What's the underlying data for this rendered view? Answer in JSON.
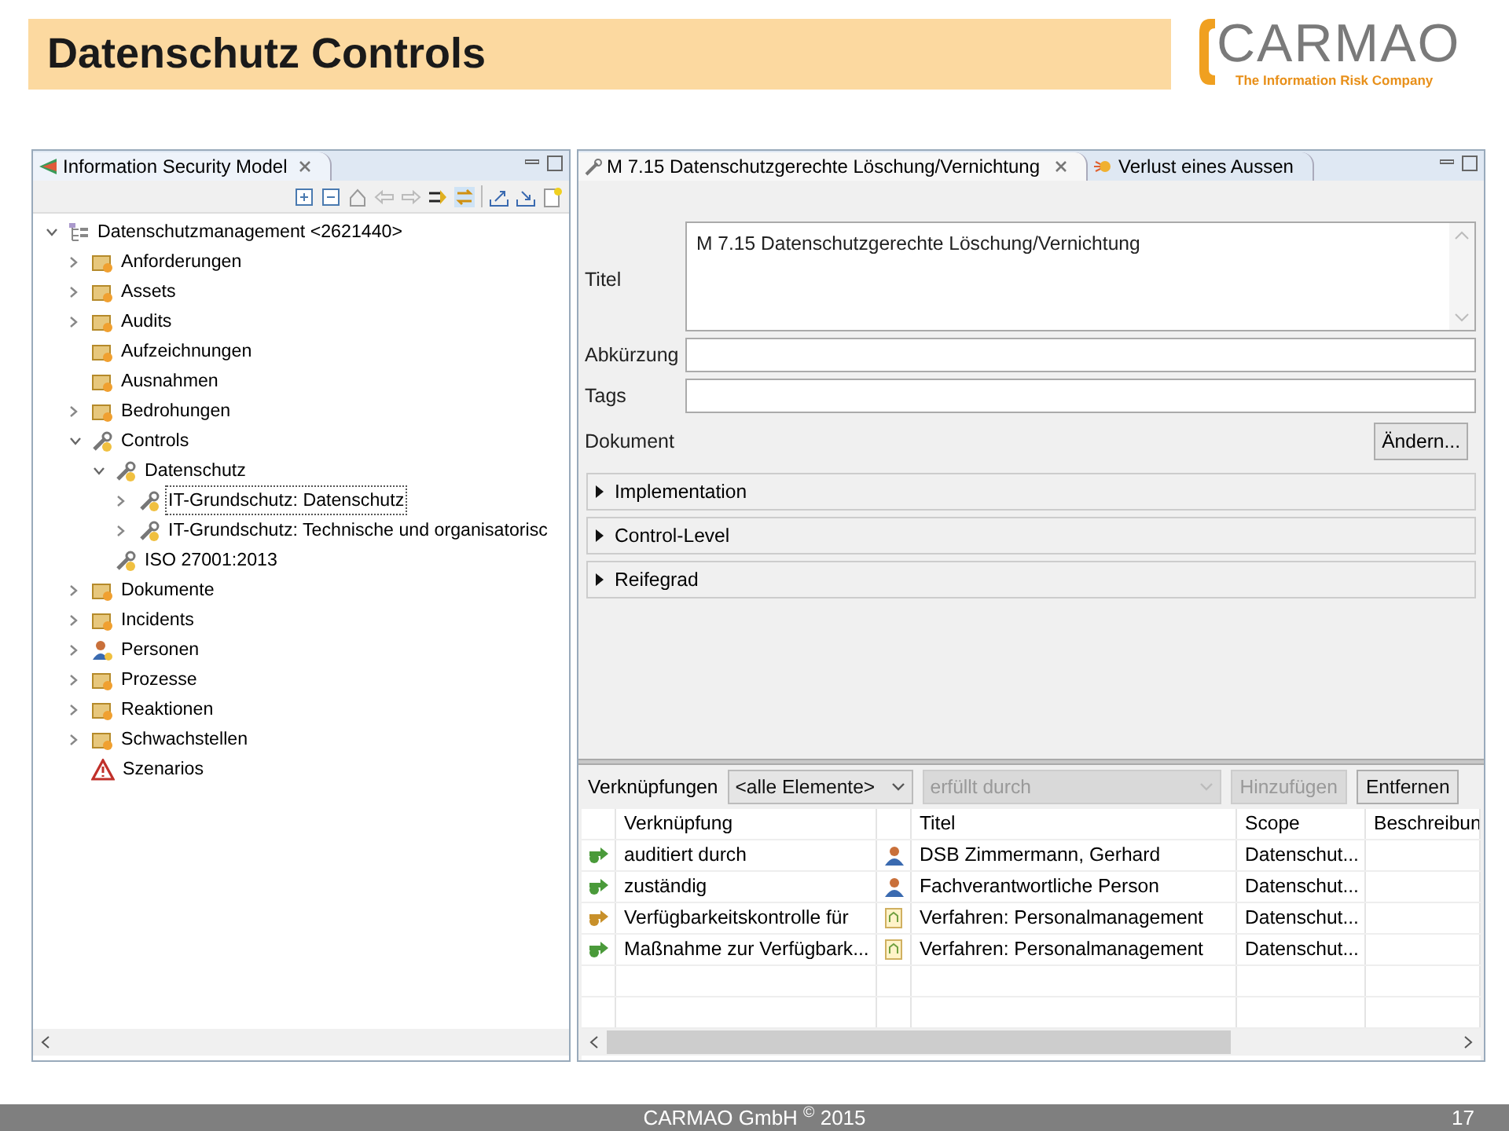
{
  "slide": {
    "title": "Datenschutz Controls",
    "logo": {
      "name": "CARMAO",
      "tagline": "The Information Risk Company"
    },
    "footer": "CARMAO GmbH $^{©}$ 2015",
    "page_number": "17"
  },
  "tree_view": {
    "tab": {
      "label": "Information Security Model",
      "selected": true
    },
    "tree": [
      {
        "label": "Datenschutzmanagement <2621440>",
        "kind": "root",
        "expanded": true,
        "selected": false,
        "children": [
          {
            "label": "Anforderungen",
            "kind": "category",
            "expanded": false,
            "selected": false
          },
          {
            "label": "Assets",
            "kind": "category",
            "expanded": false,
            "selected": false
          },
          {
            "label": "Audits",
            "kind": "category",
            "expanded": false,
            "selected": false
          },
          {
            "label": "Aufzeichnungen",
            "kind": "category",
            "selected": false
          },
          {
            "label": "Ausnahmen",
            "kind": "category",
            "selected": false
          },
          {
            "label": "Bedrohungen",
            "kind": "category",
            "expanded": false,
            "selected": false
          },
          {
            "label": "Controls",
            "kind": "control",
            "expanded": true,
            "selected": false,
            "children": [
              {
                "label": "Datenschutz",
                "kind": "control",
                "expanded": true,
                "selected": false,
                "children": [
                  {
                    "label": "IT-Grundschutz: Datenschutz",
                    "kind": "control",
                    "expanded": false,
                    "selected": true
                  },
                  {
                    "label": "IT-Grundschutz: Technische und organisatorisc",
                    "kind": "control",
                    "expanded": false,
                    "selected": false
                  }
                ]
              },
              {
                "label": "ISO 27001:2013",
                "kind": "control",
                "selected": false
              }
            ]
          },
          {
            "label": "Dokumente",
            "kind": "category",
            "expanded": false,
            "selected": false
          },
          {
            "label": "Incidents",
            "kind": "category",
            "expanded": false,
            "selected": false
          },
          {
            "label": "Personen",
            "kind": "person",
            "expanded": false,
            "selected": false
          },
          {
            "label": "Prozesse",
            "kind": "category",
            "expanded": false,
            "selected": false
          },
          {
            "label": "Reaktionen",
            "kind": "category",
            "expanded": false,
            "selected": false
          },
          {
            "label": "Schwachstellen",
            "kind": "category",
            "expanded": false,
            "selected": false
          },
          {
            "label": "Szenarios",
            "kind": "warning",
            "selected": false
          }
        ]
      }
    ]
  },
  "editor": {
    "tabs": [
      {
        "label": "M 7.15 Datenschutzgerechte Löschung/Vernichtung",
        "selected": true
      },
      {
        "label": "Verlust eines Aussen",
        "selected": false
      }
    ],
    "fields": [
      {
        "label": "Titel",
        "kind": "textarea",
        "value": "M 7.15 Datenschutzgerechte Löschung/Vernichtung"
      },
      {
        "label": "Abkürzung",
        "kind": "text"
      },
      {
        "label": "Tags",
        "kind": "text"
      },
      {
        "label": "Dokument",
        "kind": "button",
        "button": "Ändern..."
      }
    ],
    "sections": [
      {
        "label": "Implementation",
        "expanded": false
      },
      {
        "label": "Control-Level",
        "expanded": false
      },
      {
        "label": "Reifegrad",
        "expanded": false
      }
    ],
    "links": {
      "label": "Verknüpfungen",
      "filter": {
        "value": "<alle Elemente>",
        "disabled": false
      },
      "relation": {
        "value": "erfüllt durch",
        "disabled": true
      },
      "buttons": [
        {
          "label": "Hinzufügen",
          "disabled": true
        },
        {
          "label": "Entfernen",
          "disabled": false
        }
      ],
      "columns": [
        "Verknüpfung",
        "Titel",
        "Scope",
        "Beschreibun"
      ],
      "rows": [
        {
          "color": "#4a9a3a",
          "relation": "auditiert durch",
          "kind": "person",
          "title": "DSB Zimmermann, Gerhard",
          "scope": "Datenschut..."
        },
        {
          "color": "#4a9a3a",
          "relation": "zuständig",
          "kind": "person",
          "title": "Fachverantwortliche Person",
          "scope": "Datenschut..."
        },
        {
          "color": "#c8902a",
          "relation": "Verfügbarkeitskontrolle für",
          "kind": "process",
          "title": "Verfahren: Personalmanagement",
          "scope": "Datenschut..."
        },
        {
          "color": "#4a9a3a",
          "relation": "Maßnahme zur Verfügbark...",
          "kind": "process",
          "title": "Verfahren: Personalmanagement",
          "scope": "Datenschut..."
        }
      ]
    }
  }
}
